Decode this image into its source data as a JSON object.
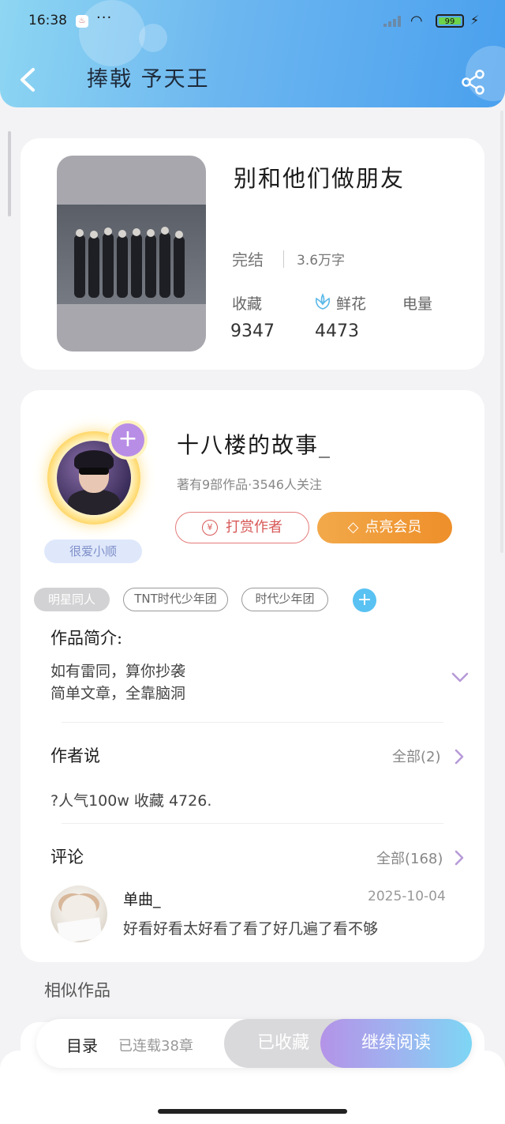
{
  "status_bar": {
    "time": "16:38",
    "dots": "···",
    "battery": "99"
  },
  "header": {
    "title": "捧戟 予天王"
  },
  "book": {
    "title": "别和他们做朋友",
    "status": "完结",
    "word_count": "3.6万字",
    "stats": [
      {
        "label": "收藏",
        "value": "9347"
      },
      {
        "label": "鲜花",
        "value": "4473"
      },
      {
        "label": "电量",
        "value": ""
      }
    ]
  },
  "author": {
    "name": "十八楼的故事_",
    "meta": "著有9部作品·3546人关注",
    "badge": "很爱小顺",
    "tip_label": "打赏作者",
    "vip_label": "点亮会员"
  },
  "tags": [
    "明星同人",
    "TNT时代少年团",
    "时代少年团"
  ],
  "intro": {
    "title": "作品简介:",
    "lines": [
      "如有雷同，算你抄袭",
      "简单文章，全靠脑洞"
    ]
  },
  "author_says": {
    "title": "作者说",
    "more": "全部(2)",
    "text": "?人气100w 收藏 4726."
  },
  "comments": {
    "title": "评论",
    "more": "全部(168)",
    "items": [
      {
        "user": "单曲_",
        "date": "2025-10-04",
        "text": "好看好看太好看了看了好几遍了看不够"
      }
    ]
  },
  "similar": {
    "title": "相似作品"
  },
  "bottom_bar": {
    "toc_label": "目录",
    "toc_count": "已连载38章",
    "fav_label": "已收藏",
    "read_label": "继续阅读"
  },
  "colors": {
    "header_gradient": [
      "#8ed6f2",
      "#4aa0ee"
    ],
    "tip_red": "#d85858",
    "vip_orange": "#ee8f2a",
    "follow_purple": "#b88de6",
    "tag_add_blue": "#59c2f2"
  }
}
